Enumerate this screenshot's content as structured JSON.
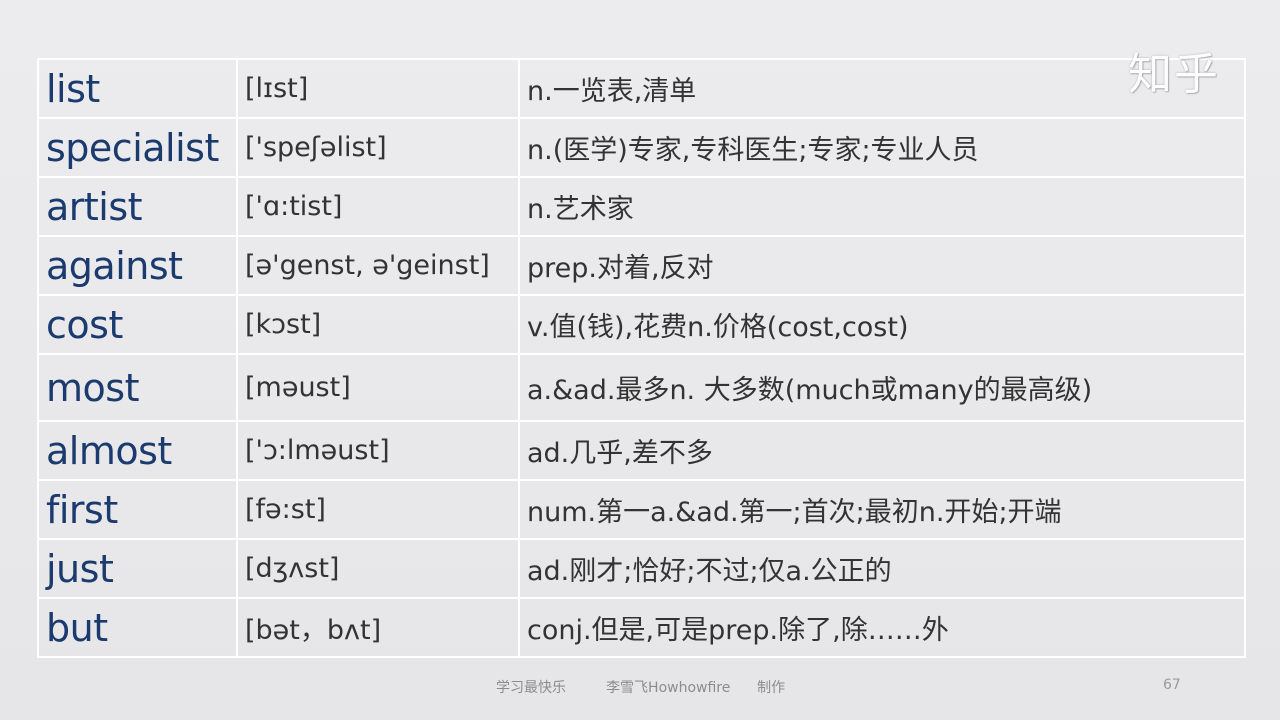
{
  "watermark": "知乎",
  "vocabulary": [
    {
      "word": "list",
      "phonetic": "[lɪst]",
      "meaning": "n.一览表,清单"
    },
    {
      "word": "specialist",
      "phonetic": "['speʃəlist]",
      "meaning": "n.(医学)专家,专科医生;专家;专业人员"
    },
    {
      "word": "artist",
      "phonetic": "['ɑ:tist]",
      "meaning": "n.艺术家"
    },
    {
      "word": "against",
      "phonetic": "[ə'genst, ə'geinst]",
      "meaning": "prep.对着,反对"
    },
    {
      "word": "cost",
      "phonetic": "[kɔst]",
      "meaning": "v.值(钱),花费n.价格(cost,cost)"
    },
    {
      "word": "most",
      "phonetic": "[məust]",
      "meaning": "a.&ad.最多n. 大多数(much或many的最高级)"
    },
    {
      "word": "almost",
      "phonetic": "['ɔ:lməust]",
      "meaning": "ad.几乎,差不多"
    },
    {
      "word": "first",
      "phonetic": "[fə:st]",
      "meaning": "num.第一a.&ad.第一;首次;最初n.开始;开端"
    },
    {
      "word": "just",
      "phonetic": "[dʒʌst]",
      "meaning": "ad.刚才;恰好;不过;仅a.公正的"
    },
    {
      "word": "but",
      "phonetic": "[bət，bʌt]",
      "meaning": "conj.但是,可是prep.除了,除……外"
    }
  ],
  "footer": {
    "slogan": "学习最快乐",
    "author": "李雪飞Howhowfire",
    "made": "制作",
    "page_number": "67"
  }
}
